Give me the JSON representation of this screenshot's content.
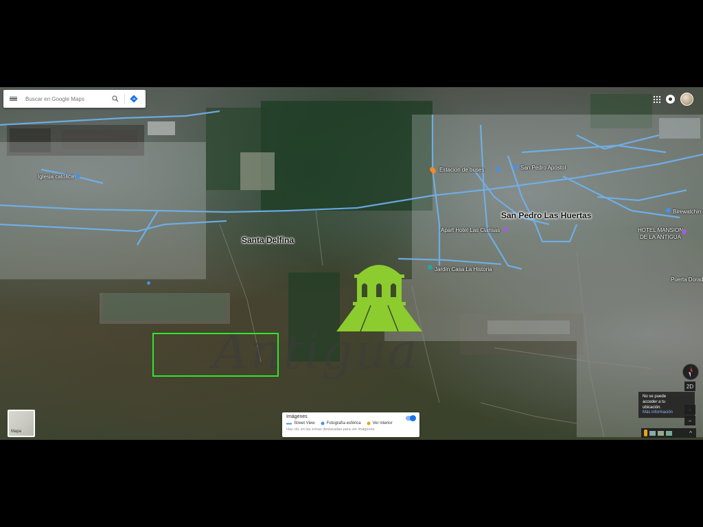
{
  "search": {
    "placeholder": "Buscar en Google Maps"
  },
  "icons": {
    "menu": "menu-icon",
    "search": "search-icon",
    "directions": "directions-icon",
    "apps": "apps-grid-icon",
    "notifications": "notifications-icon",
    "account": "account-avatar"
  },
  "map": {
    "places": [
      {
        "label": "Iglesia católica",
        "type": "church"
      },
      {
        "label": "Estación de buses",
        "type": "bus"
      },
      {
        "label": "San Pedro Apóstol",
        "type": "church"
      },
      {
        "label": "Apart Hotel Las Clarisas",
        "type": "hotel"
      },
      {
        "label": "Jardín Casa La Historia",
        "type": "park"
      },
      {
        "label": "Birewatchin",
        "type": "poi"
      },
      {
        "label": "HOTEL MANSION DE LA ANTIGUA",
        "type": "hotel"
      },
      {
        "label": "Puerta Dorad",
        "type": "poi"
      }
    ],
    "areas": [
      {
        "label": "San Pedro Las Huertas"
      },
      {
        "label": "Santa Delfina"
      }
    ],
    "colors": {
      "street_view_lines": "#6fb3f0",
      "logo_green": "#8ccc2f",
      "highlight_rect": "#2ee82e"
    }
  },
  "overlay": {
    "watermark": "Antigua"
  },
  "layers_button": {
    "label": "Mapa"
  },
  "imagery_panel": {
    "title": "Imágenes",
    "legend": [
      {
        "label": "Street View",
        "color": "#4a90e2"
      },
      {
        "label": "Fotografía esférica",
        "color": "#4a90e2"
      },
      {
        "label": "Ver interior",
        "color": "#f0a30a"
      }
    ],
    "hint": "Haz clic en las zonas destacadas para ver imágenes"
  },
  "location_info": {
    "line1": "No se puede",
    "line2": "acceder a tu",
    "line3": "ubicación.",
    "link": "Más información"
  },
  "controls": {
    "mode": "2D",
    "zoom_in": "+",
    "zoom_out": "−",
    "expand": "^"
  }
}
